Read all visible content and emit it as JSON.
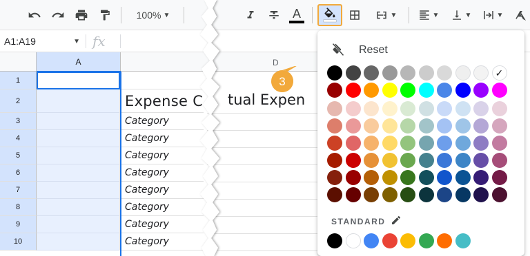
{
  "toolbar": {
    "zoom": "100%",
    "colors": {
      "active_highlight": "#f2a93b",
      "active_bg": "#d3e3fd"
    }
  },
  "formula_bar": {
    "name_box": "A1:A19",
    "fx_label": "fx"
  },
  "grid": {
    "col_a": "A",
    "col_d": "D",
    "rows": [
      "1",
      "2",
      "3",
      "4",
      "5",
      "6",
      "7",
      "8",
      "9",
      "10"
    ],
    "b_cells": [
      "",
      "Expense C",
      "Category",
      "Category",
      "Category",
      "Category",
      "Category",
      "Category",
      "Category",
      "Category"
    ],
    "d_header_text": "tual Expen"
  },
  "step_badge": {
    "number": "3",
    "color": "#f2a93b"
  },
  "fill_color_menu": {
    "reset_label": "Reset",
    "standard_label": "STANDARD",
    "palette": [
      [
        "#000000",
        "#434343",
        "#666666",
        "#999999",
        "#b7b7b7",
        "#cccccc",
        "#d9d9d9",
        "#efefef",
        "#f3f3f3",
        "#ffffff"
      ],
      [
        "#980000",
        "#ff0000",
        "#ff9900",
        "#ffff00",
        "#00ff00",
        "#00ffff",
        "#4a86e8",
        "#0000ff",
        "#9900ff",
        "#ff00ff"
      ],
      [
        "#e6b8af",
        "#f4cccc",
        "#fce5cd",
        "#fff2cc",
        "#d9ead3",
        "#d0e0e3",
        "#c9daf8",
        "#cfe2f3",
        "#d9d2e9",
        "#ead1dc"
      ],
      [
        "#dd7e6b",
        "#ea9999",
        "#f9cb9c",
        "#ffe599",
        "#b6d7a8",
        "#a2c4c9",
        "#a4c2f4",
        "#9fc5e8",
        "#b4a7d6",
        "#d5a6bd"
      ],
      [
        "#cc4125",
        "#e06666",
        "#f6b26b",
        "#ffd966",
        "#93c47d",
        "#76a5af",
        "#6d9eeb",
        "#6fa8dc",
        "#8e7cc3",
        "#c27ba0"
      ],
      [
        "#a61c00",
        "#cc0000",
        "#e69138",
        "#f1c232",
        "#6aa84f",
        "#45818e",
        "#3c78d8",
        "#3d85c6",
        "#674ea7",
        "#a64d79"
      ],
      [
        "#85200c",
        "#990000",
        "#b45f06",
        "#bf9000",
        "#38761d",
        "#134f5c",
        "#1155cc",
        "#0b5394",
        "#351c75",
        "#741b47"
      ],
      [
        "#5b0f00",
        "#660000",
        "#783f04",
        "#7f6000",
        "#274e13",
        "#0c343d",
        "#1c4587",
        "#073763",
        "#20124d",
        "#4c1130"
      ]
    ],
    "selected_swatch": "#ffffff",
    "standard_colors": [
      "#000000",
      "#ffffff",
      "#4285f4",
      "#ea4335",
      "#fbbc04",
      "#34a853",
      "#ff6d01",
      "#46bdc6"
    ]
  }
}
